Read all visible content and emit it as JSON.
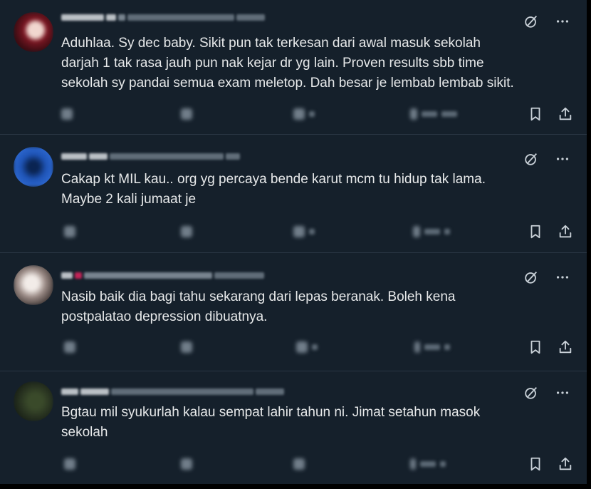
{
  "colors": {
    "background": "#15202b",
    "text": "#e7e9ea",
    "icon": "#c9d1d8",
    "divider": "#2a3644"
  },
  "replies": [
    {
      "text": "Aduhlaa. Sy dec baby. Sikit pun tak terkesan dari awal masuk sekolah\ndarjah 1 tak rasa jauh pun nak kejar dr yg lain. Proven results sbb time\nsekolah sy pandai semua exam meletop. Dah besar je lembab lembab sikit.",
      "icons": [
        "grok-icon",
        "more-icon",
        "bookmark-icon",
        "share-icon"
      ]
    },
    {
      "text": "Cakap kt MIL kau.. org yg percaya bende karut mcm tu hidup tak lama.\nMaybe 2 kali jumaat je",
      "icons": [
        "grok-icon",
        "more-icon",
        "bookmark-icon",
        "share-icon"
      ]
    },
    {
      "text": "Nasib baik dia bagi tahu sekarang dari lepas beranak. Boleh kena\npostpalatao depression dibuatnya.",
      "icons": [
        "grok-icon",
        "more-icon",
        "bookmark-icon",
        "share-icon"
      ]
    },
    {
      "text": "Bgtau mil syukurlah kalau sempat lahir tahun ni. Jimat setahun masok\nsekolah",
      "icons": [
        "grok-icon",
        "more-icon",
        "bookmark-icon",
        "share-icon"
      ]
    }
  ]
}
